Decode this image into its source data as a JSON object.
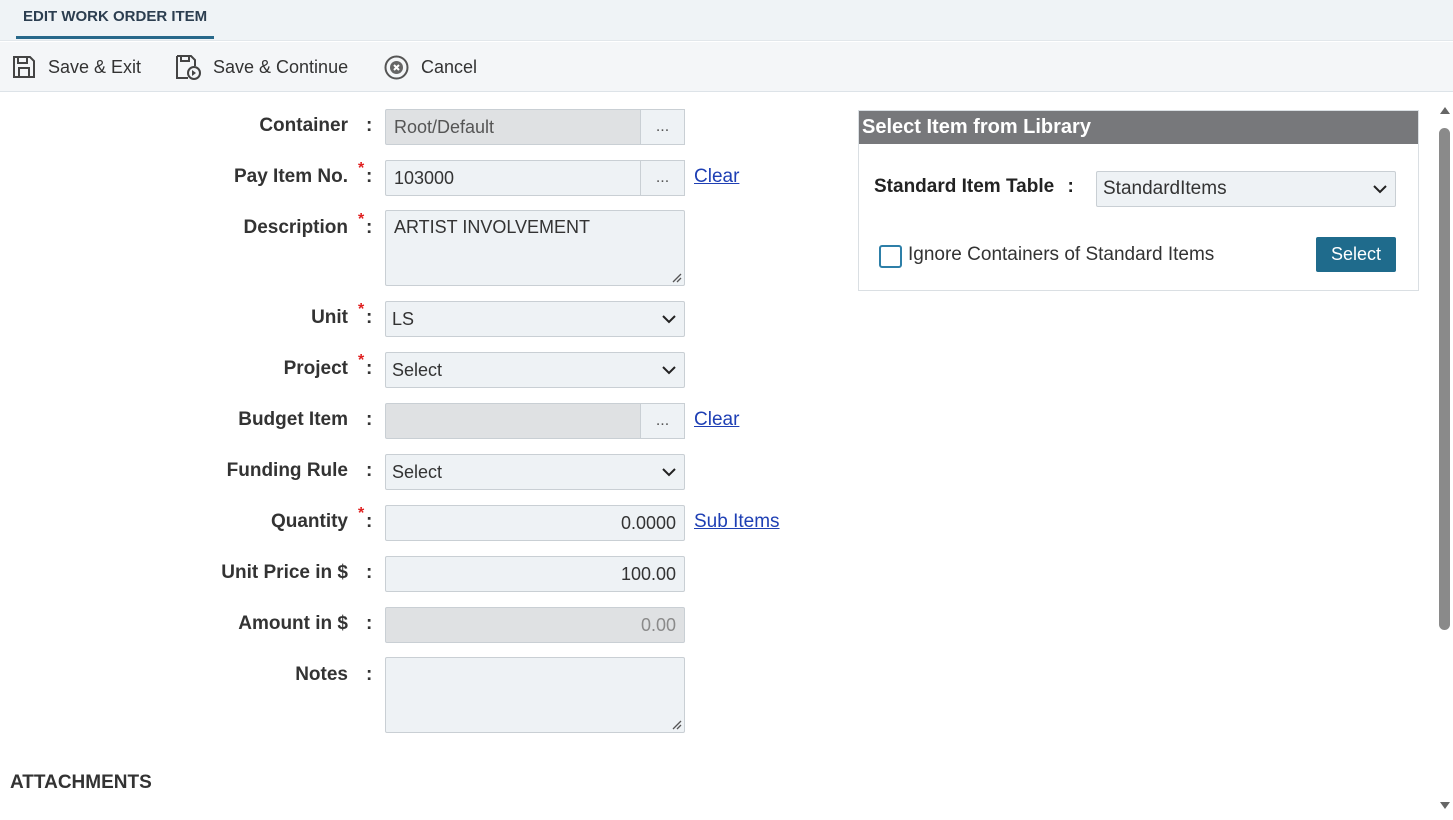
{
  "tab": {
    "title": "EDIT WORK ORDER ITEM"
  },
  "toolbar": {
    "save_exit": "Save & Exit",
    "save_continue": "Save & Continue",
    "cancel": "Cancel"
  },
  "form": {
    "container": {
      "label": "Container",
      "value": "Root/Default",
      "browse": "..."
    },
    "pay_item_no": {
      "label": "Pay Item No.",
      "value": "103000",
      "browse": "...",
      "clear": "Clear"
    },
    "description": {
      "label": "Description",
      "value": "ARTIST INVOLVEMENT"
    },
    "unit": {
      "label": "Unit",
      "value": "LS"
    },
    "project": {
      "label": "Project",
      "value": "Select"
    },
    "budget_item": {
      "label": "Budget Item",
      "value": "",
      "browse": "...",
      "clear": "Clear"
    },
    "funding_rule": {
      "label": "Funding Rule",
      "value": "Select"
    },
    "quantity": {
      "label": "Quantity",
      "value": "0.0000",
      "sub_items": "Sub Items"
    },
    "unit_price": {
      "label": "Unit Price in $",
      "value": "100.00"
    },
    "amount": {
      "label": "Amount in $",
      "value": "0.00"
    },
    "notes": {
      "label": "Notes",
      "value": ""
    },
    "colon": ":",
    "required_mark": "*"
  },
  "sections": {
    "attachments": "ATTACHMENTS"
  },
  "library": {
    "title": "Select Item from Library",
    "table_label": "Standard Item Table",
    "table_colon": ":",
    "table_value": "StandardItems",
    "ignore_containers": "Ignore Containers of Standard Items",
    "ignore_checked": false,
    "select_button": "Select"
  },
  "colors": {
    "accent": "#27688a",
    "primary_button": "#1f6b8c",
    "required": "#e02020",
    "link": "#1e3fb4",
    "panel_header": "#77787b"
  },
  "icons": {
    "save_exit": "save-icon",
    "save_continue": "save-continue-icon",
    "cancel": "cancel-circle-icon",
    "dropdown": "chevron-down-icon"
  }
}
